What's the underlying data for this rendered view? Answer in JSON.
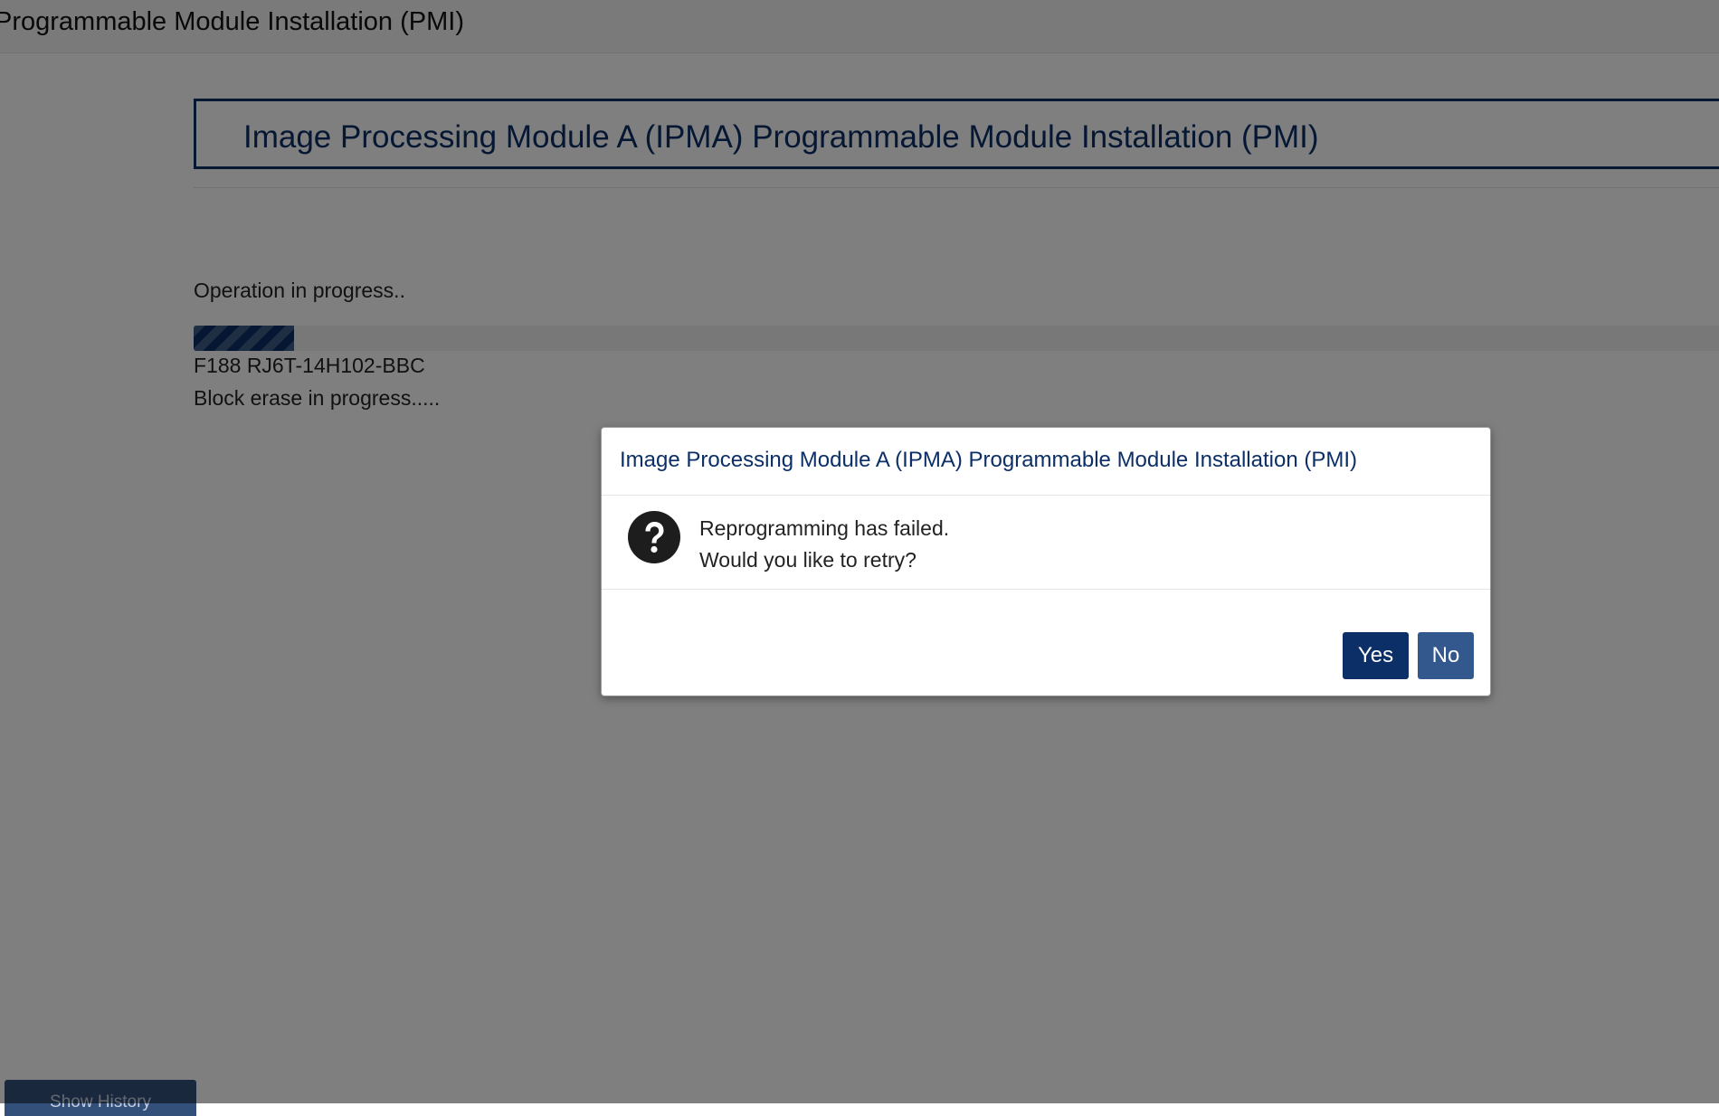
{
  "window": {
    "title": "Programmable Module Installation (PMI)"
  },
  "header": {
    "title": "Image Processing Module A (IPMA) Programmable Module Installation (PMI)"
  },
  "operation": {
    "status": "Operation in progress..",
    "progress_fraction": 0.066,
    "part_number": "F188 RJ6T-14H102-BBC",
    "step_status": "Block erase in progress....."
  },
  "footer": {
    "show_history_label": "Show History"
  },
  "dialog": {
    "title": "Image Processing Module A (IPMA) Programmable Module Installation (PMI)",
    "icon": "question-circle-icon",
    "message_line1": "Reprogramming has failed.",
    "message_line2": "Would you like to retry?",
    "yes_label": "Yes",
    "no_label": "No"
  },
  "colors": {
    "brand_navy": "#0b2f66",
    "secondary_button": "#33588e",
    "text": "#222222"
  }
}
